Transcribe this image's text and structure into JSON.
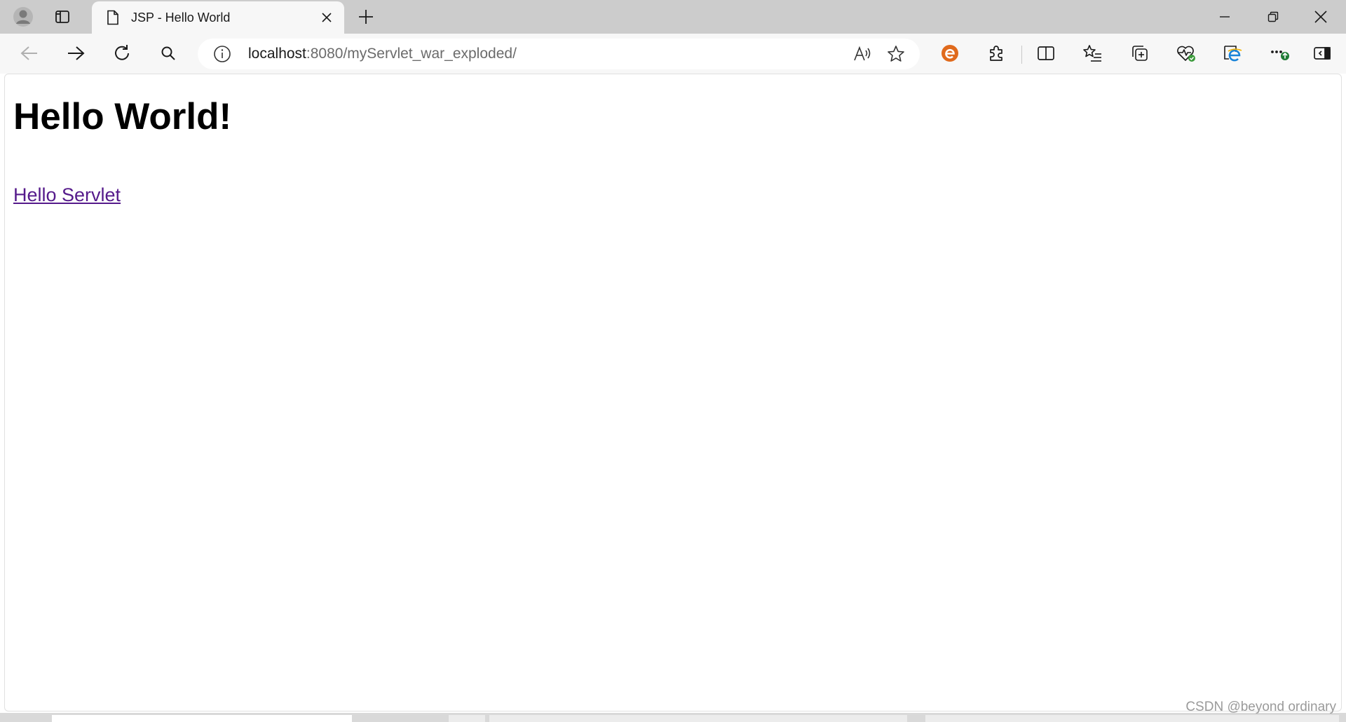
{
  "browser": {
    "tab": {
      "title": "JSP - Hello World"
    },
    "address_bar": {
      "host": "localhost",
      "path": ":8080/myServlet_war_exploded/"
    },
    "colors": {
      "frame": "#cccccc",
      "toolbar": "#f7f7f7",
      "visited_link": "#551a8b",
      "extension_accent": "#e06a1c"
    },
    "icons": {
      "profile": "profile-avatar-icon",
      "tab_actions": "tab-actions-icon",
      "favicon": "page-document-icon",
      "close_tab": "close-icon",
      "new_tab": "plus-icon",
      "minimize": "minimize-icon",
      "restore": "restore-icon",
      "close_window": "close-icon",
      "back": "arrow-left-icon",
      "forward": "arrow-right-icon",
      "refresh": "refresh-icon",
      "search": "search-icon",
      "site_info": "info-icon",
      "read_aloud": "read-aloud-icon",
      "favorite": "star-icon",
      "extension_e": "extension-e-icon",
      "extensions": "puzzle-icon",
      "split_screen": "split-screen-icon",
      "favorites": "favorites-list-icon",
      "collections": "collections-icon",
      "browser_essentials": "heart-pulse-icon",
      "ie_mode": "ie-mode-icon",
      "settings_more": "more-icon",
      "sidebar": "sidebar-icon"
    }
  },
  "page": {
    "heading": "Hello World!",
    "link_text": "Hello Servlet"
  },
  "watermark": {
    "text": "CSDN @beyond ordinary"
  }
}
